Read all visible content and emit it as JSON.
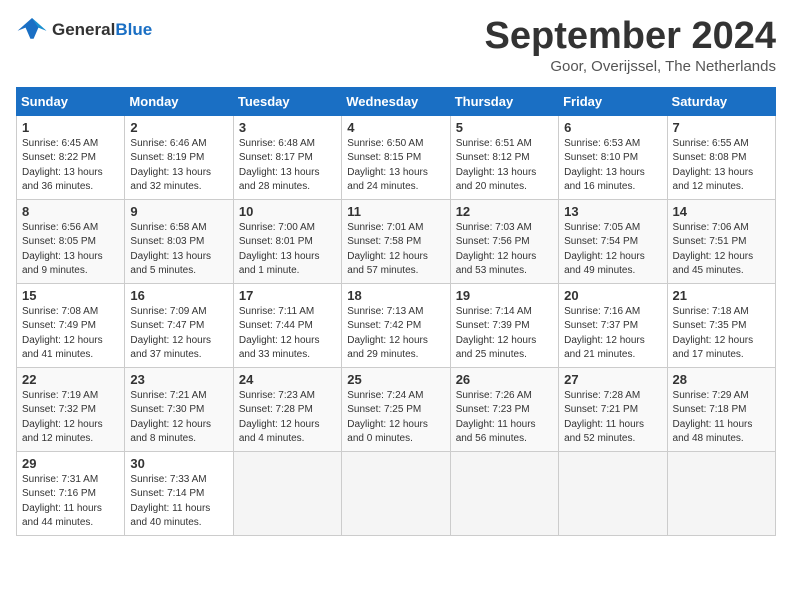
{
  "logo": {
    "line1": "General",
    "line2": "Blue"
  },
  "title": "September 2024",
  "subtitle": "Goor, Overijssel, The Netherlands",
  "weekdays": [
    "Sunday",
    "Monday",
    "Tuesday",
    "Wednesday",
    "Thursday",
    "Friday",
    "Saturday"
  ],
  "weeks": [
    [
      {
        "day": "1",
        "sunrise": "6:45 AM",
        "sunset": "8:22 PM",
        "daylight": "13 hours and 36 minutes."
      },
      {
        "day": "2",
        "sunrise": "6:46 AM",
        "sunset": "8:19 PM",
        "daylight": "13 hours and 32 minutes."
      },
      {
        "day": "3",
        "sunrise": "6:48 AM",
        "sunset": "8:17 PM",
        "daylight": "13 hours and 28 minutes."
      },
      {
        "day": "4",
        "sunrise": "6:50 AM",
        "sunset": "8:15 PM",
        "daylight": "13 hours and 24 minutes."
      },
      {
        "day": "5",
        "sunrise": "6:51 AM",
        "sunset": "8:12 PM",
        "daylight": "13 hours and 20 minutes."
      },
      {
        "day": "6",
        "sunrise": "6:53 AM",
        "sunset": "8:10 PM",
        "daylight": "13 hours and 16 minutes."
      },
      {
        "day": "7",
        "sunrise": "6:55 AM",
        "sunset": "8:08 PM",
        "daylight": "13 hours and 12 minutes."
      }
    ],
    [
      {
        "day": "8",
        "sunrise": "6:56 AM",
        "sunset": "8:05 PM",
        "daylight": "13 hours and 9 minutes."
      },
      {
        "day": "9",
        "sunrise": "6:58 AM",
        "sunset": "8:03 PM",
        "daylight": "13 hours and 5 minutes."
      },
      {
        "day": "10",
        "sunrise": "7:00 AM",
        "sunset": "8:01 PM",
        "daylight": "13 hours and 1 minute."
      },
      {
        "day": "11",
        "sunrise": "7:01 AM",
        "sunset": "7:58 PM",
        "daylight": "12 hours and 57 minutes."
      },
      {
        "day": "12",
        "sunrise": "7:03 AM",
        "sunset": "7:56 PM",
        "daylight": "12 hours and 53 minutes."
      },
      {
        "day": "13",
        "sunrise": "7:05 AM",
        "sunset": "7:54 PM",
        "daylight": "12 hours and 49 minutes."
      },
      {
        "day": "14",
        "sunrise": "7:06 AM",
        "sunset": "7:51 PM",
        "daylight": "12 hours and 45 minutes."
      }
    ],
    [
      {
        "day": "15",
        "sunrise": "7:08 AM",
        "sunset": "7:49 PM",
        "daylight": "12 hours and 41 minutes."
      },
      {
        "day": "16",
        "sunrise": "7:09 AM",
        "sunset": "7:47 PM",
        "daylight": "12 hours and 37 minutes."
      },
      {
        "day": "17",
        "sunrise": "7:11 AM",
        "sunset": "7:44 PM",
        "daylight": "12 hours and 33 minutes."
      },
      {
        "day": "18",
        "sunrise": "7:13 AM",
        "sunset": "7:42 PM",
        "daylight": "12 hours and 29 minutes."
      },
      {
        "day": "19",
        "sunrise": "7:14 AM",
        "sunset": "7:39 PM",
        "daylight": "12 hours and 25 minutes."
      },
      {
        "day": "20",
        "sunrise": "7:16 AM",
        "sunset": "7:37 PM",
        "daylight": "12 hours and 21 minutes."
      },
      {
        "day": "21",
        "sunrise": "7:18 AM",
        "sunset": "7:35 PM",
        "daylight": "12 hours and 17 minutes."
      }
    ],
    [
      {
        "day": "22",
        "sunrise": "7:19 AM",
        "sunset": "7:32 PM",
        "daylight": "12 hours and 12 minutes."
      },
      {
        "day": "23",
        "sunrise": "7:21 AM",
        "sunset": "7:30 PM",
        "daylight": "12 hours and 8 minutes."
      },
      {
        "day": "24",
        "sunrise": "7:23 AM",
        "sunset": "7:28 PM",
        "daylight": "12 hours and 4 minutes."
      },
      {
        "day": "25",
        "sunrise": "7:24 AM",
        "sunset": "7:25 PM",
        "daylight": "12 hours and 0 minutes."
      },
      {
        "day": "26",
        "sunrise": "7:26 AM",
        "sunset": "7:23 PM",
        "daylight": "11 hours and 56 minutes."
      },
      {
        "day": "27",
        "sunrise": "7:28 AM",
        "sunset": "7:21 PM",
        "daylight": "11 hours and 52 minutes."
      },
      {
        "day": "28",
        "sunrise": "7:29 AM",
        "sunset": "7:18 PM",
        "daylight": "11 hours and 48 minutes."
      }
    ],
    [
      {
        "day": "29",
        "sunrise": "7:31 AM",
        "sunset": "7:16 PM",
        "daylight": "11 hours and 44 minutes."
      },
      {
        "day": "30",
        "sunrise": "7:33 AM",
        "sunset": "7:14 PM",
        "daylight": "11 hours and 40 minutes."
      },
      null,
      null,
      null,
      null,
      null
    ]
  ]
}
